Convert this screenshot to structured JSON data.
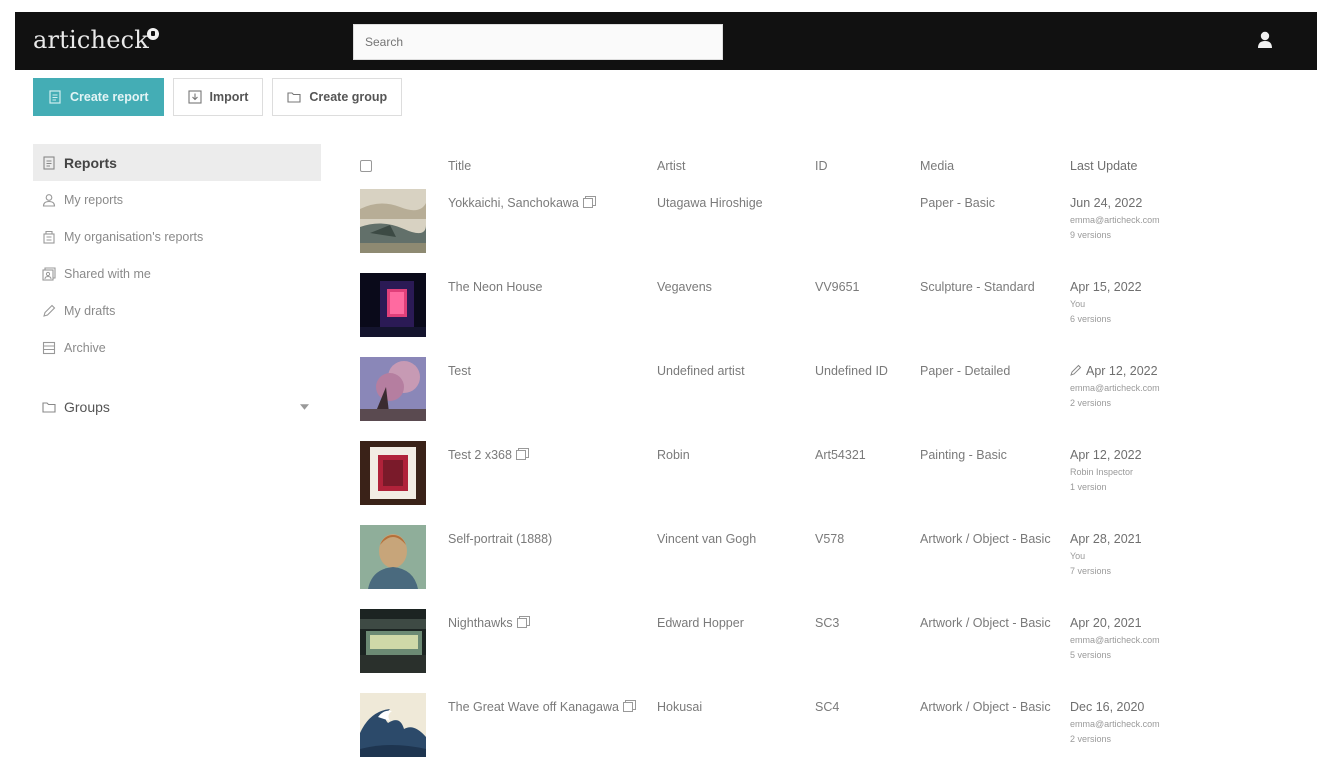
{
  "app": {
    "logo": "articheck",
    "search_placeholder": "Search"
  },
  "toolbar": {
    "create_report": "Create report",
    "import": "Import",
    "create_group": "Create group"
  },
  "sidebar": {
    "items": [
      {
        "label": "Reports"
      },
      {
        "label": "My reports"
      },
      {
        "label": "My organisation's reports"
      },
      {
        "label": "Shared with me"
      },
      {
        "label": "My drafts"
      },
      {
        "label": "Archive"
      }
    ],
    "groups_label": "Groups"
  },
  "table": {
    "headers": {
      "title": "Title",
      "artist": "Artist",
      "id": "ID",
      "media": "Media",
      "updated": "Last Update"
    },
    "rows": [
      {
        "title": "Yokkaichi, Sanchokawa",
        "shared": true,
        "artist": "Utagawa Hiroshige",
        "id": "",
        "media": "Paper - Basic",
        "date": "Jun 24, 2022",
        "by": "emma@articheck.com",
        "versions": "9 versions",
        "draft": false
      },
      {
        "title": "The Neon House",
        "shared": false,
        "artist": "Vegavens",
        "id": "VV9651",
        "media": "Sculpture - Standard",
        "date": "Apr 15, 2022",
        "by": "You",
        "versions": "6 versions",
        "draft": false
      },
      {
        "title": "Test",
        "shared": false,
        "artist": "Undefined artist",
        "id": "Undefined ID",
        "media": "Paper - Detailed",
        "date": "Apr 12, 2022",
        "by": "emma@articheck.com",
        "versions": "2 versions",
        "draft": true
      },
      {
        "title": "Test 2 x368",
        "shared": true,
        "artist": "Robin",
        "id": "Art54321",
        "media": "Painting - Basic",
        "date": "Apr 12, 2022",
        "by": "Robin Inspector",
        "versions": "1 version",
        "draft": false
      },
      {
        "title": "Self-portrait (1888)",
        "shared": false,
        "artist": "Vincent van Gogh",
        "id": "V578",
        "media": "Artwork / Object - Basic",
        "date": "Apr 28, 2021",
        "by": "You",
        "versions": "7 versions",
        "draft": false
      },
      {
        "title": "Nighthawks",
        "shared": true,
        "artist": "Edward Hopper",
        "id": "SC3",
        "media": "Artwork / Object - Basic",
        "date": "Apr 20, 2021",
        "by": "emma@articheck.com",
        "versions": "5 versions",
        "draft": false
      },
      {
        "title": "The Great Wave off Kanagawa",
        "shared": true,
        "artist": "Hokusai",
        "id": "SC4",
        "media": "Artwork / Object - Basic",
        "date": "Dec 16, 2020",
        "by": "emma@articheck.com",
        "versions": "2 versions",
        "draft": false
      }
    ]
  }
}
